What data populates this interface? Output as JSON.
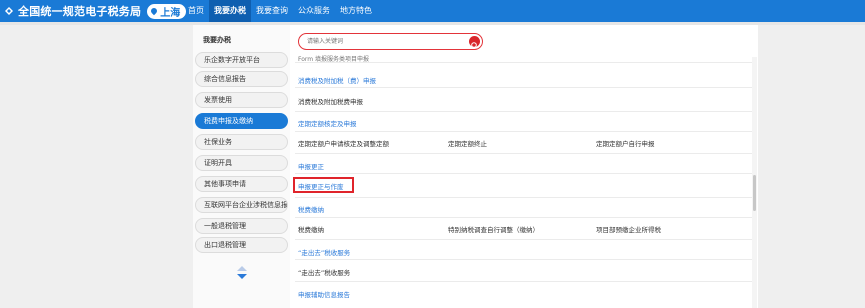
{
  "header": {
    "brand_title": "全国统一规范电子税务局",
    "region": "上海",
    "nav": [
      {
        "label": "首页",
        "active": false
      },
      {
        "label": "我要办税",
        "active": true
      },
      {
        "label": "我要查询",
        "active": false
      },
      {
        "label": "公众服务",
        "active": false
      },
      {
        "label": "地方特色",
        "active": false
      }
    ]
  },
  "sidebar": {
    "title": "我要办税",
    "items": [
      {
        "label": "乐企数字开放平台",
        "active": false
      },
      {
        "label": "综合信息报告",
        "active": false
      },
      {
        "label": "发票使用",
        "active": false
      },
      {
        "label": "税费申报及缴纳",
        "active": true
      },
      {
        "label": "社保业务",
        "active": false
      },
      {
        "label": "证明开具",
        "active": false
      },
      {
        "label": "其他事项申请",
        "active": false
      },
      {
        "label": "互联网平台企业涉税信息报送",
        "active": false
      },
      {
        "label": "一般退税管理",
        "active": false
      },
      {
        "label": "出口退税管理",
        "active": false
      }
    ]
  },
  "search": {
    "placeholder": "请输入关键词"
  },
  "content": {
    "cut_row": "Form 填报服务类项目申报",
    "sec_consumption": "消费税及附加税（费）申报",
    "consumption_item": "消费税及附加税费申报",
    "sec_fixed": "定期定额核定及申报",
    "fixed_items": [
      "定期定额户申请核定及调整定额",
      "定期定额终止",
      "定期定额户自行申报"
    ],
    "sec_correction": "申报更正",
    "correction_void": "申报更正与作废",
    "sec_payment": "税费缴纳",
    "payment_items": [
      "税费缴纳",
      "特别纳税调查自行调整（缴纳）",
      "项目部预缴企业所得税"
    ],
    "sec_goingout": "“走出去”税收服务",
    "goingout_item": "“走出去”税收服务",
    "sec_auxiliary": "申报辅助信息报告"
  }
}
